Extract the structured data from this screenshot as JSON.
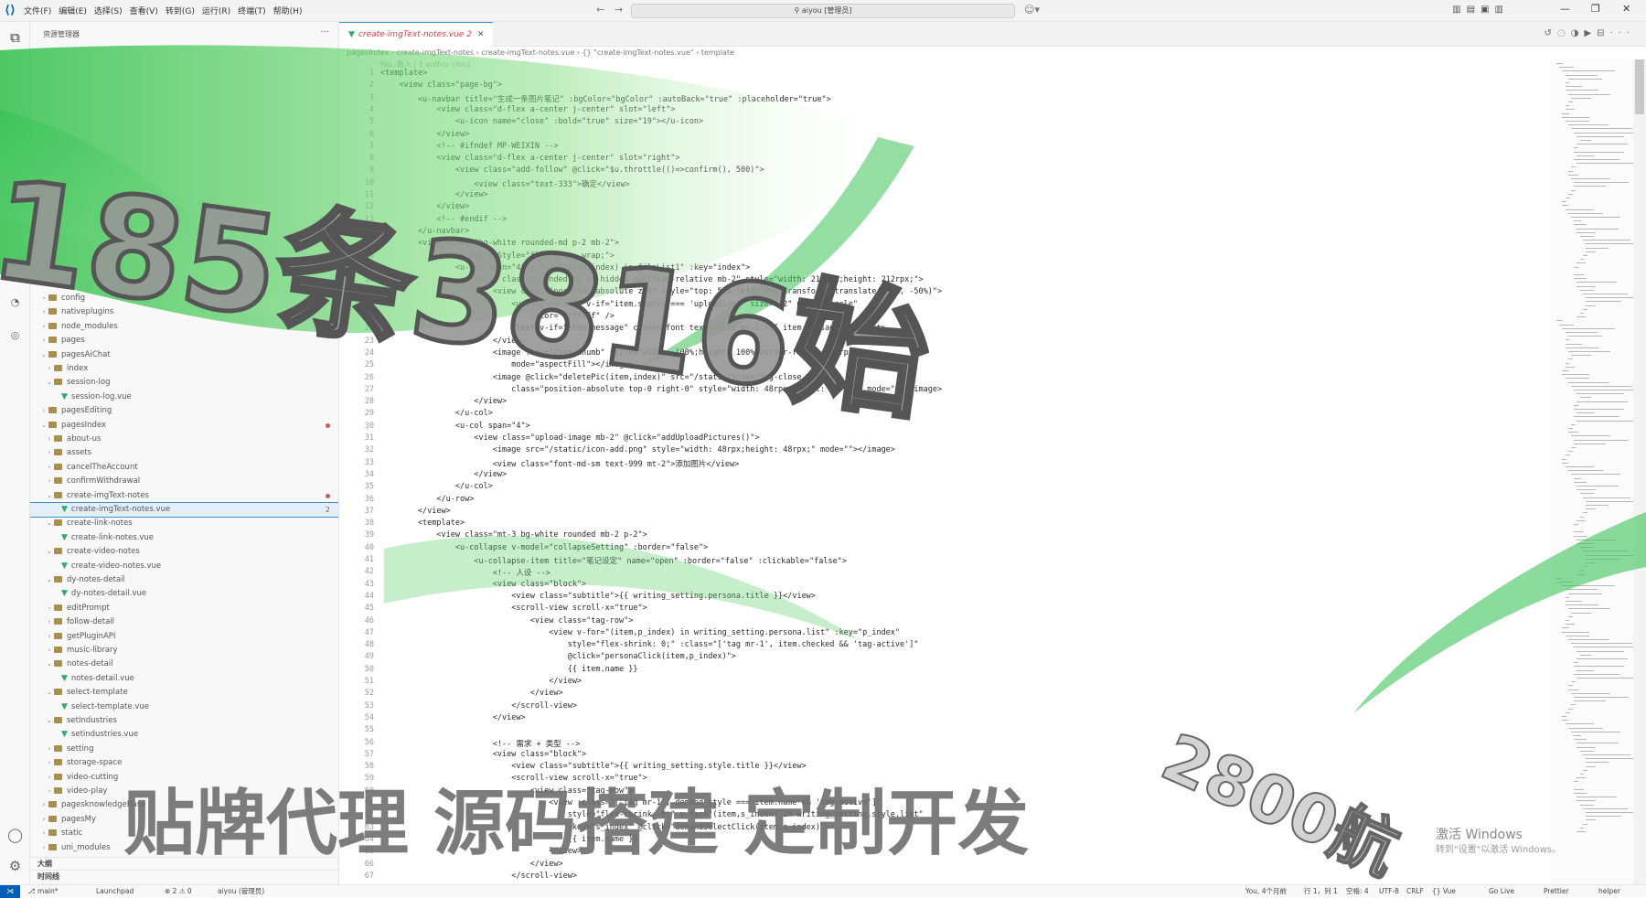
{
  "menu": [
    "文件(F)",
    "编辑(E)",
    "选择(S)",
    "查看(V)",
    "转到(G)",
    "运行(R)",
    "终端(T)",
    "帮助(H)"
  ],
  "title_search": "aiyou [管理员]",
  "sidebar": {
    "header": "资源管理器",
    "items": [
      {
        "label": "config",
        "level": 1,
        "type": "folder",
        "open": false
      },
      {
        "label": "nativeplugins",
        "level": 1,
        "type": "folder",
        "open": false
      },
      {
        "label": "node_modules",
        "level": 1,
        "type": "folder",
        "open": false
      },
      {
        "label": "pages",
        "level": 1,
        "type": "folder",
        "open": false
      },
      {
        "label": "pagesAiChat",
        "level": 1,
        "type": "folder",
        "open": true
      },
      {
        "label": "index",
        "level": 2,
        "type": "folder",
        "open": false
      },
      {
        "label": "session-log",
        "level": 2,
        "type": "folder",
        "open": true
      },
      {
        "label": "session-log.vue",
        "level": 3,
        "type": "vue"
      },
      {
        "label": "pagesEditing",
        "level": 1,
        "type": "folder",
        "open": false
      },
      {
        "label": "pagesIndex",
        "level": 1,
        "type": "folder",
        "open": true,
        "dot": true
      },
      {
        "label": "about-us",
        "level": 2,
        "type": "folder",
        "open": false
      },
      {
        "label": "assets",
        "level": 2,
        "type": "folder",
        "open": false
      },
      {
        "label": "cancelTheAccount",
        "level": 2,
        "type": "folder",
        "open": false
      },
      {
        "label": "confirmWithdrawal",
        "level": 2,
        "type": "folder",
        "open": false
      },
      {
        "label": "create-imgText-notes",
        "level": 2,
        "type": "folder",
        "open": true,
        "dot": true
      },
      {
        "label": "create-imgText-notes.vue",
        "level": 3,
        "type": "vue",
        "selected": true,
        "badge": "2"
      },
      {
        "label": "create-link-notes",
        "level": 2,
        "type": "folder",
        "open": true
      },
      {
        "label": "create-link-notes.vue",
        "level": 3,
        "type": "vue"
      },
      {
        "label": "create-video-notes",
        "level": 2,
        "type": "folder",
        "open": true
      },
      {
        "label": "create-video-notes.vue",
        "level": 3,
        "type": "vue"
      },
      {
        "label": "dy-notes-detail",
        "level": 2,
        "type": "folder",
        "open": true
      },
      {
        "label": "dy-notes-detail.vue",
        "level": 3,
        "type": "vue"
      },
      {
        "label": "editPrompt",
        "level": 2,
        "type": "folder",
        "open": false
      },
      {
        "label": "follow-detail",
        "level": 2,
        "type": "folder",
        "open": false
      },
      {
        "label": "getPluginAPI",
        "level": 2,
        "type": "folder",
        "open": false
      },
      {
        "label": "music-library",
        "level": 2,
        "type": "folder",
        "open": false
      },
      {
        "label": "notes-detail",
        "level": 2,
        "type": "folder",
        "open": true
      },
      {
        "label": "notes-detail.vue",
        "level": 3,
        "type": "vue"
      },
      {
        "label": "select-template",
        "level": 2,
        "type": "folder",
        "open": true
      },
      {
        "label": "select-template.vue",
        "level": 3,
        "type": "vue"
      },
      {
        "label": "setIndustries",
        "level": 2,
        "type": "folder",
        "open": true
      },
      {
        "label": "setindustries.vue",
        "level": 3,
        "type": "vue"
      },
      {
        "label": "setting",
        "level": 2,
        "type": "folder",
        "open": false
      },
      {
        "label": "storage-space",
        "level": 2,
        "type": "folder",
        "open": false
      },
      {
        "label": "video-cutting",
        "level": 2,
        "type": "folder",
        "open": false
      },
      {
        "label": "video-play",
        "level": 2,
        "type": "folder",
        "open": false
      },
      {
        "label": "pagesknowledgeBase",
        "level": 1,
        "type": "folder",
        "open": false
      },
      {
        "label": "pagesMy",
        "level": 1,
        "type": "folder",
        "open": false
      },
      {
        "label": "static",
        "level": 1,
        "type": "folder",
        "open": false
      },
      {
        "label": "uni_modules",
        "level": 1,
        "type": "folder",
        "open": false
      }
    ],
    "outline_label": "大纲",
    "timeline_label": "时间线"
  },
  "tab": {
    "label": "create-imgText-notes.vue 2"
  },
  "breadcrumb": "pagesIndex › create-imgText-notes › create-imgText-notes.vue › {} \"create-imgText-notes.vue\" › template",
  "blame": "You, 数入 | 1 author (You)",
  "code_lines": [
    "<template>",
    "    <view class=\"page-bg\">",
    "        <u-navbar title=\"生成一条图片笔记\" :bgColor=\"bgColor\" :autoBack=\"true\" :placeholder=\"true\">",
    "            <view class=\"d-flex a-center j-center\" slot=\"left\">",
    "                <u-icon name=\"close\" :bold=\"true\" size=\"19\"></u-icon>",
    "            </view>",
    "            <!-- #ifndef MP-WEIXIN -->",
    "            <view class=\"d-flex a-center j-center\" slot=\"right\">",
    "                <view class=\"add-follow\" @click=\"$u.throttle(()=>confirm(), 500)\">",
    "                    <view class=\"text-333\">确定</view>",
    "                </view>",
    "            </view>",
    "            <!-- #endif -->",
    "        </u-navbar>",
    "        <view class=\"bg-white rounded-md p-2 mb-2\">",
    "            <u-row customStyle=\"flex-wrap: wrap;\">",
    "                <u-col span=\"4\" v-for=\"(item,index) in fileList1\" :key=\"index\">",
    "                    <view class=\"rounded-md of-hidden position-relative mb-2\" style=\"width: 212rpx;height: 212rpx;\">",
    "                        <view class=\"position-absolute z99\" style=\"top: 50%;left: 50%;transform: translate(-50%, -50%)\">",
    "                            <u-loading-icon v-if=\"item.status === 'uploading'\" size=\"22\" mode=\"circle\"",
    "                                color=\"#ffffff\" />",
    "                            <text v-if=\"item.message\" class=\"font text-white mt-1\">{{ item.message }}</text>",
    "                        </view>",
    "                        <image :src=\"item.thumb\" style=\"width: 100%;height: 100%;border-radius: 20rpx;\"",
    "                            mode=\"aspectFill\"></image>",
    "                        <image @click=\"deletePic(item,index)\" src=\"/static/index/img-close.png\"",
    "                            class=\"position-absolute top-0 right-0\" style=\"width: 48rpx;height: 48rpx;\" mode=\"\"></image>",
    "                    </view>",
    "                </u-col>",
    "                <u-col span=\"4\">",
    "                    <view class=\"upload-image mb-2\" @click=\"addUploadPictures()\">",
    "                        <image src=\"/static/icon-add.png\" style=\"width: 48rpx;height: 48rpx;\" mode=\"\"></image>",
    "                        <view class=\"font-md-sm text-999 mt-2\">添加图片</view>",
    "                    </view>",
    "                </u-col>",
    "            </u-row>",
    "        </view>",
    "        <template>",
    "            <view class=\"mt-3 bg-white rounded mb-2 p-2\">",
    "                <u-collapse v-model=\"collapseSetting\" :border=\"false\">",
    "                    <u-collapse-item title=\"笔记设定\" name=\"open\" :border=\"false\" :clickable=\"false\">",
    "                        <!-- 人设 -->",
    "                        <view class=\"block\">",
    "                            <view class=\"subtitle\">{{ writing_setting.persona.title }}</view>",
    "                            <scroll-view scroll-x=\"true\">",
    "                                <view class=\"tag-row\">",
    "                                    <view v-for=\"(item,p_index) in writing_setting.persona.list\" :key=\"p_index\"",
    "                                        style=\"flex-shrink: 0;\" :class=\"['tag mr-1', item.checked && 'tag-active']\"",
    "                                        @click=\"personaClick(item,p_index)\">",
    "                                        {{ item.name }}",
    "                                    </view>",
    "                                </view>",
    "                            </scroll-view>",
    "                        </view>",
    "",
    "                        <!-- 需求 + 类型 -->",
    "                        <view class=\"block\">",
    "                            <view class=\"subtitle\">{{ writing_setting.style.title }}</view>",
    "                            <scroll-view scroll-x=\"true\">",
    "                                <view class=\"tag-row\">",
    "                                    <view :class=\"['tag mr-1', demand_style === item.name && 'tag-active']\"",
    "                                        style=\"flex-shrink: 0;\" v-for=\"(item,s_index) in writing_setting.style.list\"",
    "                                        :key=\"s_index\" @click=\"demandSelectClick(item,s_index)\">",
    "                                        {{ item.name }}",
    "                                    </view>",
    "                                </view>",
    "                            </scroll-view>"
  ],
  "statusbar": {
    "branch": "main*",
    "launchpad": "Launchpad",
    "problems": "⊗ 2 ⚠ 0",
    "workspace": "aiyou (管理员)",
    "blame": "You, 4个月前",
    "position": "行 1，列 1",
    "spaces": "空格: 4",
    "encoding": "UTF-8",
    "eol": "CRLF",
    "language": "{} Vue",
    "golive": "Go Live",
    "prettier": "Prettier",
    "helper": "helper"
  },
  "watermark": {
    "big_text": "185条3816始",
    "bottom_text": "贴牌代理 源码搭建 定制开发",
    "corner_text": "2800航"
  },
  "windows_activation": {
    "title": "激活 Windows",
    "subtitle": "转到\"设置\"以激活 Windows。"
  },
  "colors": {
    "accent": "#005fb8",
    "vue_green": "#2fa86b",
    "folder": "#a9904a",
    "modified": "#d14545",
    "overlay_green": "#3cc35a"
  }
}
